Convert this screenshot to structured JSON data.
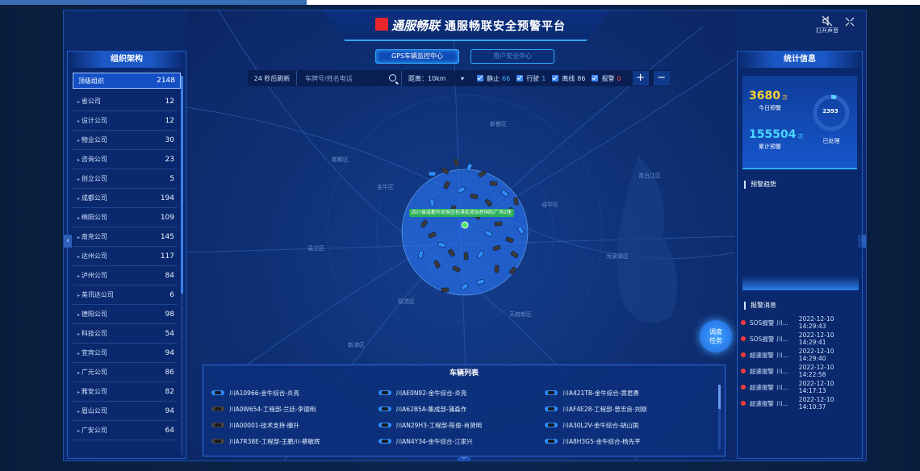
{
  "header": {
    "logo_text": "通服畅联",
    "title": "通服畅联安全预警平台",
    "sound_label": "打开声音"
  },
  "tabs": [
    {
      "label": "GPS车辆监控中心",
      "active": true
    },
    {
      "label": "用户安全中心",
      "active": false
    }
  ],
  "toolbar": {
    "refresh": "24 秒后刷新",
    "search_placeholder": "车牌号/姓名电话",
    "distance_label": "距离：10km",
    "filters": [
      {
        "label": "静止",
        "count": "66",
        "color": "#4aa8ff"
      },
      {
        "label": "行驶",
        "count": "1",
        "color": "#4aa8ff"
      },
      {
        "label": "离线",
        "count": "86",
        "color": "#cfe3ff"
      },
      {
        "label": "报警",
        "count": "0",
        "color": "#ff4a4a"
      }
    ],
    "zoom_in": "+",
    "zoom_out": "−"
  },
  "org": {
    "title": "组织架构",
    "root": {
      "name": "顶级组织",
      "count": "2148"
    },
    "items": [
      {
        "name": "省公司",
        "count": "12"
      },
      {
        "name": "设计公司",
        "count": "12"
      },
      {
        "name": "物业公司",
        "count": "30"
      },
      {
        "name": "咨询公司",
        "count": "23"
      },
      {
        "name": "创立公司",
        "count": "5"
      },
      {
        "name": "成都公司",
        "count": "194"
      },
      {
        "name": "绵阳公司",
        "count": "109"
      },
      {
        "name": "南充公司",
        "count": "145"
      },
      {
        "name": "达州公司",
        "count": "117"
      },
      {
        "name": "泸州公司",
        "count": "84"
      },
      {
        "name": "美讯达公司",
        "count": "6"
      },
      {
        "name": "德阳公司",
        "count": "98"
      },
      {
        "name": "科技公司",
        "count": "54"
      },
      {
        "name": "宜宾公司",
        "count": "94"
      },
      {
        "name": "广元公司",
        "count": "86"
      },
      {
        "name": "雅安公司",
        "count": "82"
      },
      {
        "name": "眉山公司",
        "count": "94"
      },
      {
        "name": "广安公司",
        "count": "64"
      }
    ]
  },
  "stats": {
    "title": "统计信息",
    "today_value": "3680",
    "today_unit": "次",
    "today_label": "今日预警",
    "total_value": "155504",
    "total_unit": "次",
    "total_label": "累计预警",
    "handled_value": "2393",
    "handled_label": "已处理",
    "handled_fraction": 0.05,
    "trend_title": "预警趋势",
    "alerts_title": "报警消息",
    "alerts": [
      {
        "type": "SOS报警",
        "org": "川...",
        "time": "2022-12-10 14:29:43"
      },
      {
        "type": "SOS报警",
        "org": "川...",
        "time": "2022-12-10 14:29:41"
      },
      {
        "type": "超速报警",
        "org": "川...",
        "time": "2022-12-10 14:29:40"
      },
      {
        "type": "超速报警",
        "org": "川...",
        "time": "2022-12-10 14:22:58"
      },
      {
        "type": "超速报警",
        "org": "川...",
        "time": "2022-12-10 14:17:13"
      },
      {
        "type": "超速报警",
        "org": "川...",
        "time": "2022-12-10 14:10:37"
      }
    ]
  },
  "map": {
    "location_label": "四川省成都市武侯区桂溪街道仙桥国际广场2座",
    "dispatch_label": "调度任务",
    "labels": [
      "新都区",
      "郫都区",
      "金牛区",
      "成华区",
      "龙泉驿区",
      "双流区",
      "温江区",
      "天府新区",
      "青白江区",
      "新津区"
    ]
  },
  "vehicles": {
    "title": "车辆列表",
    "items": [
      {
        "plate": "川A10966-金牛综合-炎亮",
        "color": "blue"
      },
      {
        "plate": "川AE0N92-金牛综合-炎亮",
        "color": "blue"
      },
      {
        "plate": "川A421TB-金牛综合-黄君勇",
        "color": "blue"
      },
      {
        "plate": "川A0W654-工程部-兰廷-李德明",
        "color": "dark"
      },
      {
        "plate": "川A62B5A-集成部-蒲森作",
        "color": "blue"
      },
      {
        "plate": "川AF4E28-工程部-曾忠良-刘刚",
        "color": "blue"
      },
      {
        "plate": "川A00001-技术支持-滕升",
        "color": "dark"
      },
      {
        "plate": "川AN29H3-工程部-陈俊-肖贤明",
        "color": "blue"
      },
      {
        "plate": "川A30L2V-金牛综合-胡山国",
        "color": "blue"
      },
      {
        "plate": "川A7R38E-工程部-王鹏川-蔡敏辉",
        "color": "dark"
      },
      {
        "plate": "川AN4Y34-金牛综合-江家兴",
        "color": "blue"
      },
      {
        "plate": "川A8H3G5-金牛综合-杨先平",
        "color": "blue"
      }
    ]
  }
}
